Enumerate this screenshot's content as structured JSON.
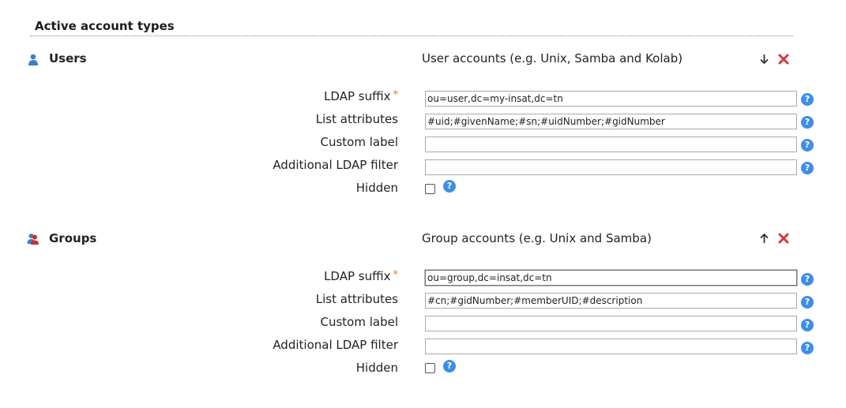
{
  "section": {
    "title": "Active account types"
  },
  "accounts": [
    {
      "name": "Users",
      "description": "User accounts (e.g. Unix, Samba and Kolab)",
      "fields": {
        "ldap_suffix": {
          "label": "LDAP suffix",
          "required_mark": "*",
          "value": "ou=user,dc=my-insat,dc=tn"
        },
        "list_attributes": {
          "label": "List attributes",
          "value": "#uid;#givenName;#sn;#uidNumber;#gidNumber"
        },
        "custom_label": {
          "label": "Custom label",
          "value": ""
        },
        "additional_filter": {
          "label": "Additional LDAP filter",
          "value": ""
        },
        "hidden": {
          "label": "Hidden",
          "checked": false
        }
      },
      "move_icon": "arrow-down-icon"
    },
    {
      "name": "Groups",
      "description": "Group accounts (e.g. Unix and Samba)",
      "fields": {
        "ldap_suffix": {
          "label": "LDAP suffix",
          "required_mark": "*",
          "value": "ou=group,dc=insat,dc=tn"
        },
        "list_attributes": {
          "label": "List attributes",
          "value": "#cn;#gidNumber;#memberUID;#description"
        },
        "custom_label": {
          "label": "Custom label",
          "value": ""
        },
        "additional_filter": {
          "label": "Additional LDAP filter",
          "value": ""
        },
        "hidden": {
          "label": "Hidden",
          "checked": false
        }
      },
      "move_icon": "arrow-up-icon"
    }
  ],
  "help_glyph": "?",
  "colors": {
    "help": "#3d8ee8",
    "remove": "#d9363e",
    "required": "#e8781e"
  }
}
